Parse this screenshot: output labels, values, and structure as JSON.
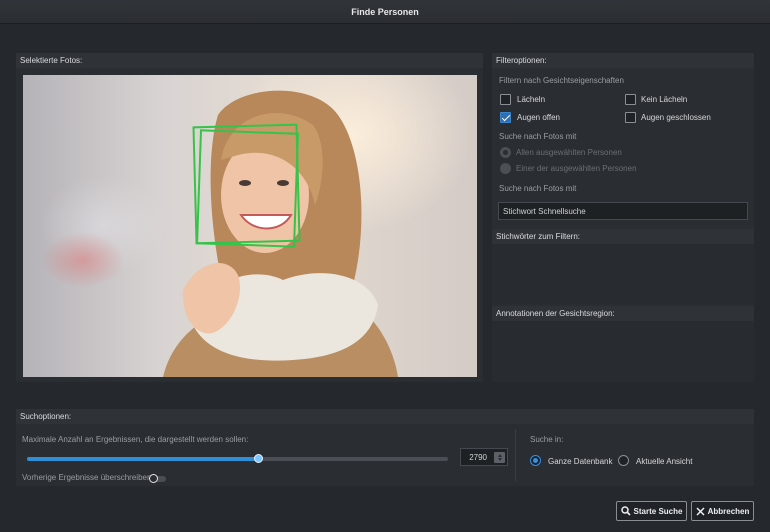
{
  "window": {
    "title": "Finde Personen"
  },
  "photos_panel": {
    "title": "Selektierte Fotos:"
  },
  "filter_panel": {
    "title": "Filteroptionen:",
    "face_props_label": "Filtern nach Gesichtseigenschaften",
    "checkboxes": [
      {
        "label": "Lächeln",
        "checked": false
      },
      {
        "label": "Kein Lächeln",
        "checked": false
      },
      {
        "label": "Augen offen",
        "checked": true
      },
      {
        "label": "Augen geschlossen",
        "checked": false
      }
    ],
    "search_mode_label": "Suche nach Fotos mit",
    "search_mode_options": [
      {
        "label": "Allen ausgewählten Personen",
        "selected": true,
        "disabled": true
      },
      {
        "label": "Einer der ausgewählten Personen",
        "selected": false,
        "disabled": true
      }
    ],
    "keyword_search_label": "Suche nach Fotos mit",
    "keyword_search_value": "Stichwort Schnellsuche"
  },
  "keywords_panel": {
    "title": "Stichwörter zum Filtern:"
  },
  "annotations_panel": {
    "title": "Annotationen der Gesichtsregion:"
  },
  "search_options": {
    "title": "Suchoptionen:",
    "max_results_label": "Maximale Anzahl an Ergebnissen, die dargestellt werden sollen:",
    "max_results_value": "2790",
    "slider_fraction": 0.55,
    "overwrite_label": "Vorherige Ergebnisse überschreiben:",
    "overwrite_on": false,
    "search_in_label": "Suche in:",
    "search_in_options": [
      {
        "label": "Ganze Datenbank",
        "selected": true
      },
      {
        "label": "Aktuelle Ansicht",
        "selected": false
      }
    ]
  },
  "buttons": {
    "start_label": "Starte Suche",
    "cancel_label": "Abbrechen"
  },
  "colors": {
    "accent": "#2e8fd8",
    "face_box": "#37c34a",
    "background": "#25282c"
  },
  "icons": {
    "start": "search-icon",
    "cancel": "close-icon"
  }
}
